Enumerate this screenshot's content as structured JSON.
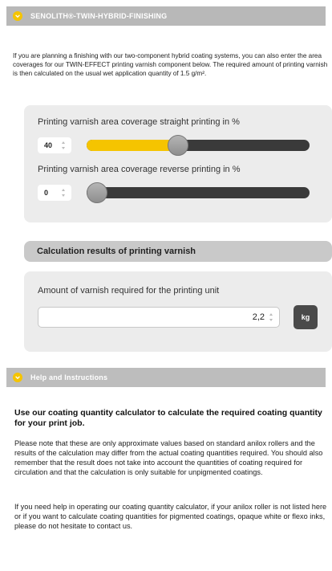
{
  "header": {
    "title": "SENOLITH®-TWIN-HYBRID-FINISHING",
    "icon": "chevron-down-icon"
  },
  "intro_text": "If you are planning a finishing with our two-component hybrid coating systems, you can also enter the area coverages for our TWIN-EFFECT printing varnish component below. The required amount of printing varnish is then calculated on the usual wet application quantity of 1.5 g/m².",
  "sliders": {
    "straight": {
      "label": "Printing varnish area coverage straight printing in %",
      "value": "40",
      "fraction": 0.4
    },
    "reverse": {
      "label": "Printing varnish area coverage reverse printing in %",
      "value": "0",
      "fraction": 0.0
    }
  },
  "results": {
    "heading": "Calculation results of printing varnish",
    "label": "Amount of varnish required for the printing unit",
    "value": "2,2",
    "unit": "kg"
  },
  "help": {
    "title": "Help and Instructions",
    "icon": "chevron-down-icon",
    "heading": "Use our coating quantity calculator to calculate the required coating quantity for your print job.",
    "paragraph1": "Please note that these are only approximate values based on standard anilox rollers and the results of the calculation may differ from the actual coating quantities required. You should also remember that the result does not take into account the quantities of coating required for circulation and that the calculation is only suitable for unpigmented coatings.",
    "paragraph2": "If you need help in operating our coating quantity calculator, if your anilox roller is not listed here or if you want to calculate coating quantities for pigmented coatings, opaque white or flexo inks, please do not hesitate to contact us."
  },
  "colors": {
    "accent": "#f5c400",
    "header_bg": "#b8b8b8",
    "track": "#3a3a3a",
    "panel_bg": "#ececec"
  }
}
